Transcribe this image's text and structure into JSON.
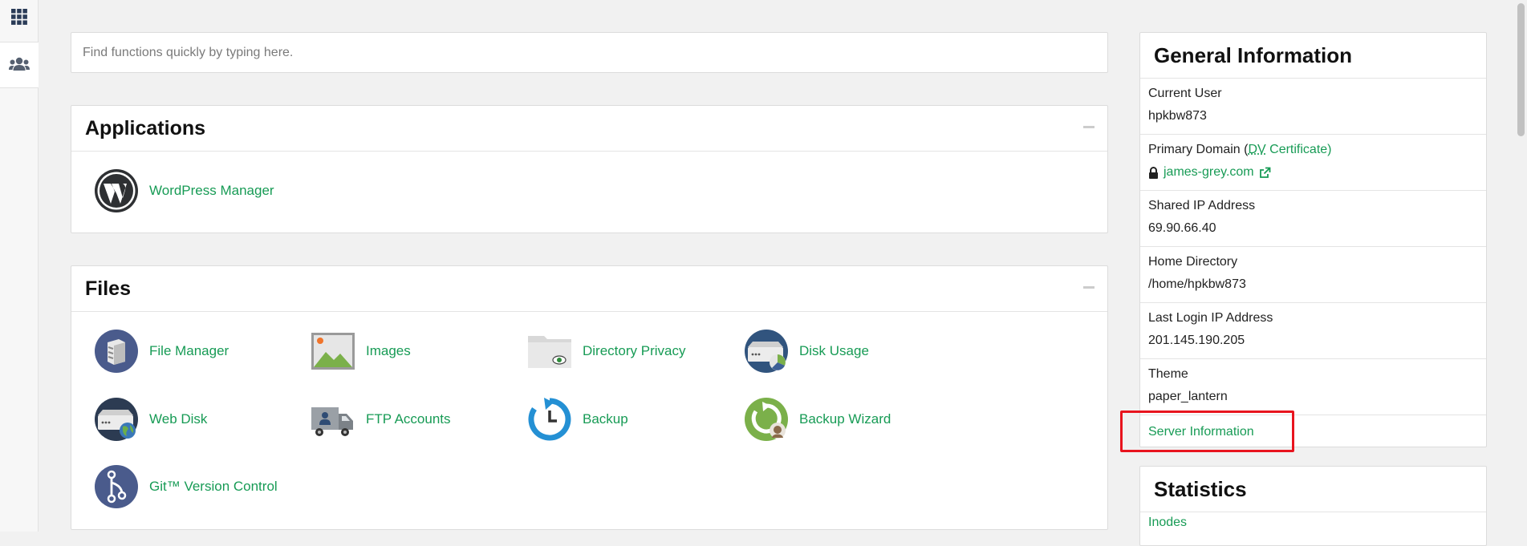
{
  "rail": {
    "grid_icon": "grid-icon",
    "users_icon": "users-icon"
  },
  "search": {
    "placeholder": "Find functions quickly by typing here."
  },
  "applications": {
    "title": "Applications",
    "items": [
      {
        "label": "WordPress Manager",
        "icon": "wordpress-icon"
      }
    ]
  },
  "files": {
    "title": "Files",
    "items": [
      {
        "label": "File Manager",
        "icon": "file-manager-icon"
      },
      {
        "label": "Images",
        "icon": "images-icon"
      },
      {
        "label": "Directory Privacy",
        "icon": "directory-privacy-icon"
      },
      {
        "label": "Disk Usage",
        "icon": "disk-usage-icon"
      },
      {
        "label": "Web Disk",
        "icon": "web-disk-icon"
      },
      {
        "label": "FTP Accounts",
        "icon": "ftp-accounts-icon"
      },
      {
        "label": "Backup",
        "icon": "backup-icon"
      },
      {
        "label": "Backup Wizard",
        "icon": "backup-wizard-icon"
      },
      {
        "label": "Git™ Version Control",
        "icon": "git-icon"
      }
    ]
  },
  "general_info": {
    "title": "General Information",
    "current_user_label": "Current User",
    "current_user": "hpkbw873",
    "primary_domain_label": "Primary Domain (",
    "dv": "DV",
    "certificate": " Certificate)",
    "domain": "james-grey.com",
    "shared_ip_label": "Shared IP Address",
    "shared_ip": "69.90.66.40",
    "home_dir_label": "Home Directory",
    "home_dir": "/home/hpkbw873",
    "last_login_label": "Last Login IP Address",
    "last_login": "201.145.190.205",
    "theme_label": "Theme",
    "theme": "paper_lantern",
    "server_info_link": "Server Information"
  },
  "statistics": {
    "title": "Statistics",
    "first_item": "Inodes"
  },
  "colors": {
    "accent_green": "#179b55",
    "highlight_red": "#e8141e"
  }
}
